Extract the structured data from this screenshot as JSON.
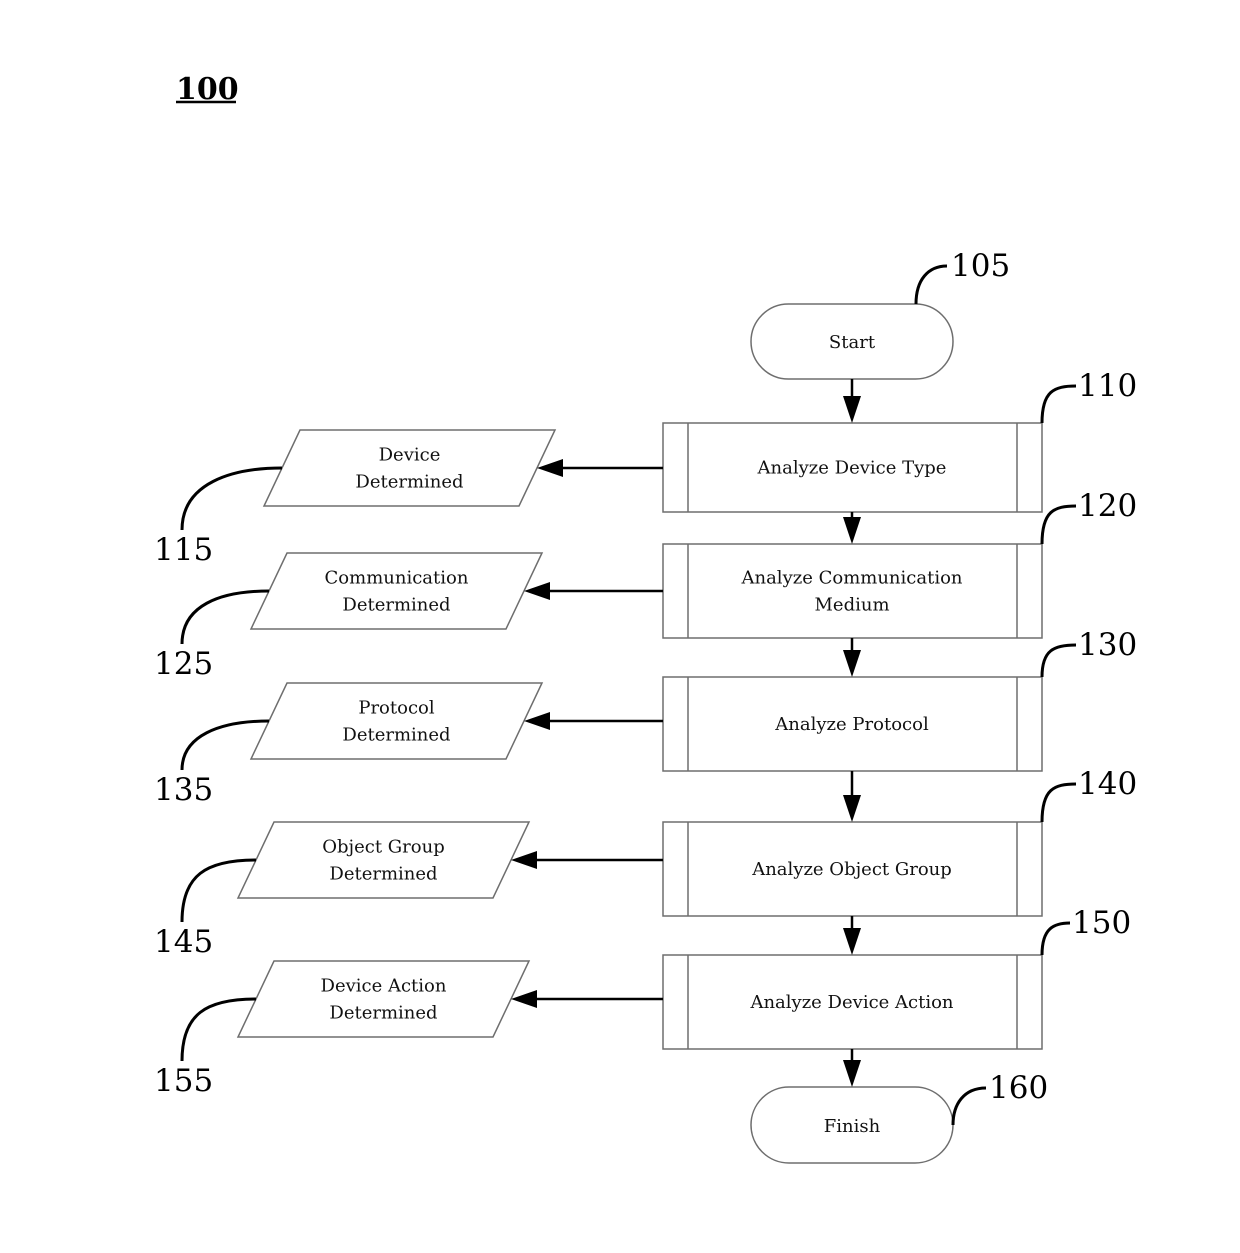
{
  "figure": {
    "label": "100"
  },
  "terminals": [
    {
      "id": "start",
      "ref": "105",
      "label": "Start"
    },
    {
      "id": "finish",
      "ref": "160",
      "label": "Finish"
    }
  ],
  "processes": [
    {
      "ref": "110",
      "lines": [
        "Analyze Device Type"
      ]
    },
    {
      "ref": "120",
      "lines": [
        "Analyze Communication",
        "Medium"
      ]
    },
    {
      "ref": "130",
      "lines": [
        "Analyze Protocol"
      ]
    },
    {
      "ref": "140",
      "lines": [
        "Analyze Object Group"
      ]
    },
    {
      "ref": "150",
      "lines": [
        "Analyze Device Action"
      ]
    }
  ],
  "outputs": [
    {
      "ref": "115",
      "lines": [
        "Device",
        "Determined"
      ]
    },
    {
      "ref": "125",
      "lines": [
        "Communication",
        "Determined"
      ]
    },
    {
      "ref": "135",
      "lines": [
        "Protocol",
        "Determined"
      ]
    },
    {
      "ref": "145",
      "lines": [
        "Object Group",
        "Determined"
      ]
    },
    {
      "ref": "155",
      "lines": [
        "Device Action",
        "Determined"
      ]
    }
  ],
  "edges": [
    {
      "from": "105",
      "to": "110"
    },
    {
      "from": "110",
      "to": "120"
    },
    {
      "from": "120",
      "to": "130"
    },
    {
      "from": "130",
      "to": "140"
    },
    {
      "from": "140",
      "to": "150"
    },
    {
      "from": "150",
      "to": "160"
    },
    {
      "from": "110",
      "to": "115"
    },
    {
      "from": "120",
      "to": "125"
    },
    {
      "from": "130",
      "to": "135"
    },
    {
      "from": "140",
      "to": "145"
    },
    {
      "from": "150",
      "to": "155"
    }
  ]
}
